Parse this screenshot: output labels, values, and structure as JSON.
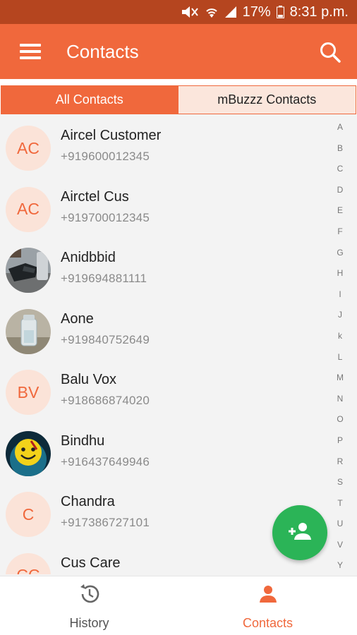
{
  "status_bar": {
    "battery": "17%",
    "time": "8:31 p.m.",
    "icons": [
      "mute-icon",
      "wifi-icon",
      "signal-icon",
      "battery-icon"
    ]
  },
  "app_bar": {
    "title": "Contacts",
    "icons": [
      "menu-icon",
      "search-icon"
    ]
  },
  "tabs": [
    {
      "label": "All Contacts",
      "active": true
    },
    {
      "label": "mBuzzz Contacts",
      "active": false
    }
  ],
  "contacts": [
    {
      "name": "Aircel Customer",
      "phone": "+919600012345",
      "initials": "AC"
    },
    {
      "name": "Airctel Cus",
      "phone": "+919700012345",
      "initials": "AC"
    },
    {
      "name": "Anidbbid",
      "phone": "+919694881111",
      "initials": ""
    },
    {
      "name": "Aone",
      "phone": "+919840752649",
      "initials": ""
    },
    {
      "name": "Balu Vox",
      "phone": "+918686874020",
      "initials": "BV"
    },
    {
      "name": "Bindhu",
      "phone": "+916437649946",
      "initials": ""
    },
    {
      "name": "Chandra",
      "phone": "+917386727101",
      "initials": "C"
    },
    {
      "name": "Cus Care",
      "phone": "",
      "initials": "CC"
    }
  ],
  "alphabet": [
    "A",
    "B",
    "C",
    "D",
    "E",
    "F",
    "G",
    "H",
    "I",
    "J",
    "k",
    "L",
    "M",
    "N",
    "O",
    "P",
    "R",
    "S",
    "T",
    "U",
    "V",
    "Y"
  ],
  "fab": {
    "icon": "add-contact-icon"
  },
  "bottom_nav": [
    {
      "label": "History",
      "icon": "history-icon",
      "active": false
    },
    {
      "label": "Contacts",
      "icon": "person-icon",
      "active": true
    }
  ],
  "colors": {
    "accent": "#f0683c",
    "status_bar": "#b5451f",
    "fab": "#2bb457",
    "avatar_bg": "#fbe3d8"
  }
}
